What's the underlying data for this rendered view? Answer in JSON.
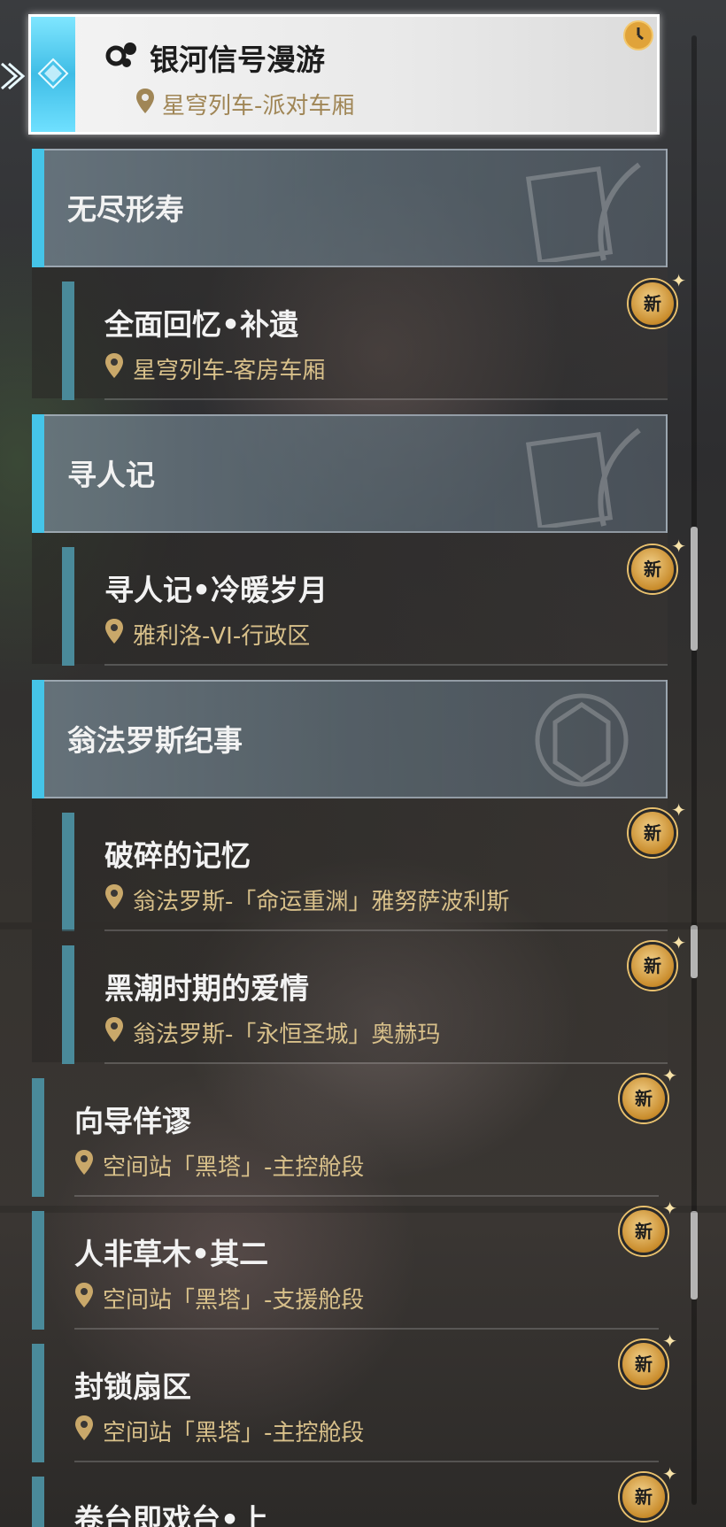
{
  "selected": {
    "title": "银河信号漫游",
    "location": "星穹列车-派对车厢"
  },
  "groups": [
    {
      "header": "无尽形寿"
    },
    {
      "header": "寻人记"
    },
    {
      "header": "翁法罗斯纪事"
    }
  ],
  "items": [
    {
      "title": "全面回忆•补遗",
      "location": "星穹列车-客房车厢",
      "badge": "新"
    },
    {
      "title": "寻人记•冷暖岁月",
      "location": "雅利洛-VI-行政区",
      "badge": "新"
    },
    {
      "title": "破碎的记忆",
      "location": "翁法罗斯-「命运重渊」雅努萨波利斯",
      "badge": "新"
    },
    {
      "title": "黑潮时期的爱情",
      "location": "翁法罗斯-「永恒圣城」奥赫玛",
      "badge": "新"
    },
    {
      "title": "向导佯谬",
      "location": "空间站「黑塔」-主控舱段",
      "badge": "新"
    },
    {
      "title": "人非草木•其二",
      "location": "空间站「黑塔」-支援舱段",
      "badge": "新"
    },
    {
      "title": "封锁扇区",
      "location": "空间站「黑塔」-主控舱段",
      "badge": "新"
    },
    {
      "title": "卷台即戏台•上",
      "badge": "新"
    }
  ],
  "colors": {
    "accent_cyan": "#45c4e8",
    "location_gold": "#d8c08a",
    "badge_gold": "#c98c2c"
  }
}
